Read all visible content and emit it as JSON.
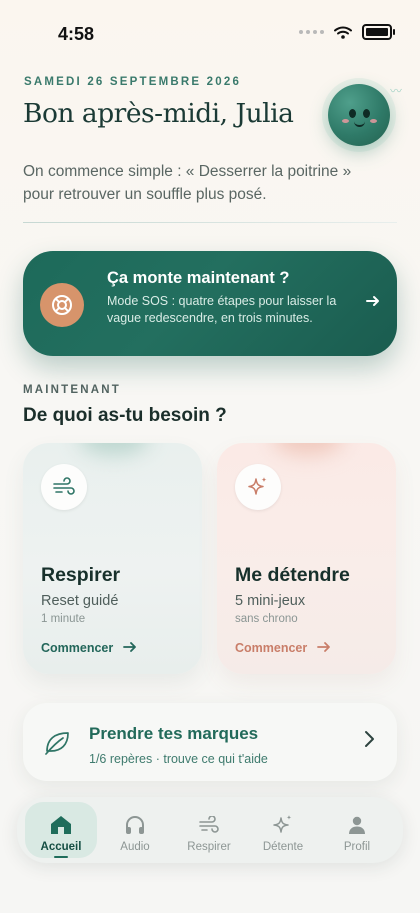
{
  "status_bar": {
    "time": "4:58"
  },
  "header": {
    "date": "SAMEDI 26 SEPTEMBRE 2026",
    "greeting": "Bon après-midi, Julia",
    "intro": "On commence simple : « Desserrer la poitrine » pour retrouver un souffle plus posé."
  },
  "sos": {
    "title": "Ça monte maintenant ?",
    "subtitle": "Mode SOS : quatre étapes pour laisser la vague redescendre, en trois minutes.",
    "icon": "lifebuoy-icon"
  },
  "section": {
    "eyebrow": "MAINTENANT",
    "title": "De quoi as-tu besoin ?"
  },
  "cards": [
    {
      "title": "Respirer",
      "subtitle": "Reset guidé",
      "meta": "1 minute",
      "cta": "Commencer",
      "icon": "wind-icon",
      "accent": "#23665a"
    },
    {
      "title": "Me détendre",
      "subtitle": "5 mini-jeux",
      "meta": "sans chrono",
      "cta": "Commencer",
      "icon": "sparkle-icon",
      "accent": "#c97e69"
    }
  ],
  "marks": {
    "title": "Prendre tes marques",
    "subtitle": "1/6 repères · trouve ce qui t'aide",
    "progress_fraction": 0.1667,
    "icon": "leaf-icon"
  },
  "tabbar": {
    "tabs": [
      {
        "label": "Accueil",
        "icon": "home-icon",
        "active": true
      },
      {
        "label": "Audio",
        "icon": "headphones-icon",
        "active": false
      },
      {
        "label": "Respirer",
        "icon": "wind-icon",
        "active": false
      },
      {
        "label": "Détente",
        "icon": "sparkle-icon",
        "active": false
      },
      {
        "label": "Profil",
        "icon": "person-icon",
        "active": false
      }
    ]
  },
  "colors": {
    "primary": "#1d6a5a",
    "accent_warm": "#d7946b",
    "background": "#f7f7f4"
  }
}
